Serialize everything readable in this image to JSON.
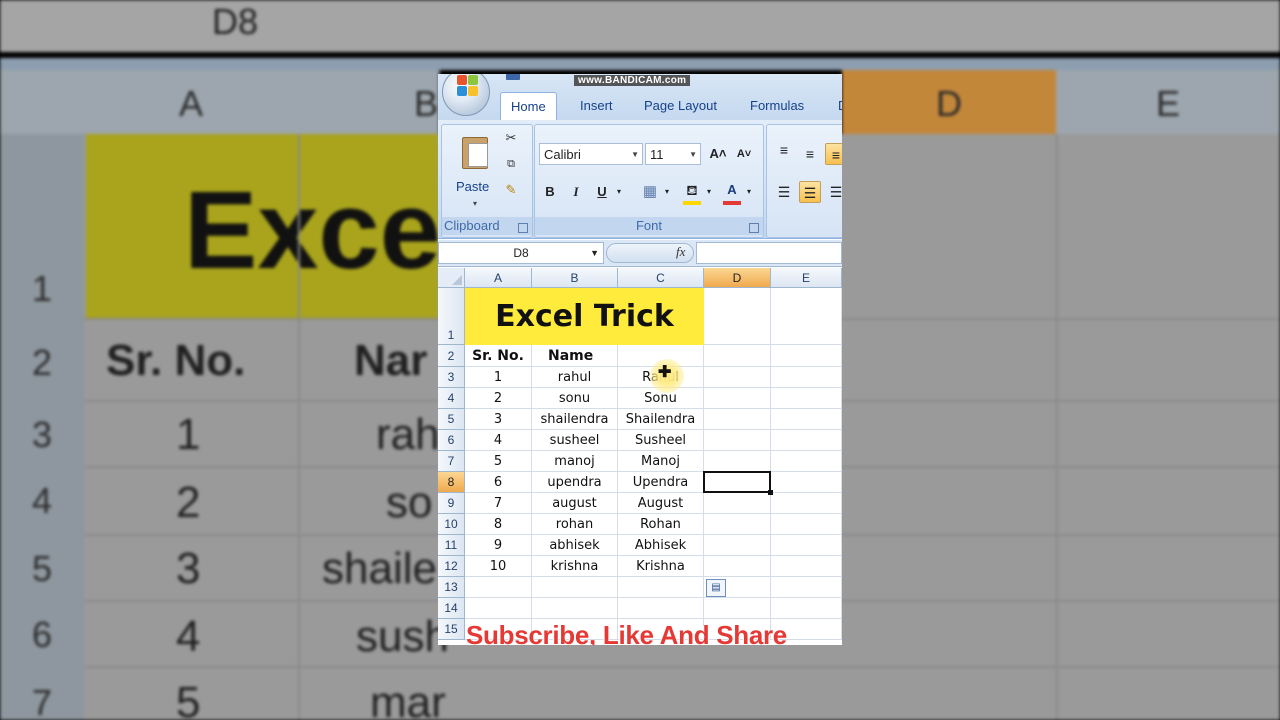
{
  "watermark": "www.BANDICAM.com",
  "ribbon": {
    "tabs": [
      "Home",
      "Insert",
      "Page Layout",
      "Formulas",
      "D"
    ],
    "active_tab": "Home",
    "clipboard": {
      "paste_label": "Paste",
      "group_label": "Clipboard"
    },
    "font": {
      "font_name": "Calibri",
      "font_size": "11",
      "group_label": "Font",
      "bold": "B",
      "italic": "I",
      "underline": "U",
      "grow": "A˄",
      "shrink": "A˅",
      "font_color_letter": "A",
      "fill_color": "#ffd700",
      "font_color": "#e53935"
    },
    "alignment": {
      "note": ""
    }
  },
  "formula_bar": {
    "name_box": "D8",
    "fx": "fx",
    "value": ""
  },
  "sheet": {
    "columns": [
      "A",
      "B",
      "C",
      "D",
      "E"
    ],
    "selected_column": "D",
    "selected_row": "8",
    "rows": [
      "1",
      "2",
      "3",
      "4",
      "5",
      "6",
      "7",
      "8",
      "9",
      "10",
      "11",
      "12",
      "13",
      "14",
      "15"
    ],
    "title": "Excel Trick",
    "headers": {
      "a": "Sr. No.",
      "b": "Name"
    },
    "data": [
      {
        "a": "1",
        "b": "rahul",
        "c": "Rahul"
      },
      {
        "a": "2",
        "b": "sonu",
        "c": "Sonu"
      },
      {
        "a": "3",
        "b": "shailendra",
        "c": "Shailendra"
      },
      {
        "a": "4",
        "b": "susheel",
        "c": "Susheel"
      },
      {
        "a": "5",
        "b": "manoj",
        "c": "Manoj"
      },
      {
        "a": "6",
        "b": "upendra",
        "c": "Upendra"
      },
      {
        "a": "7",
        "b": "august",
        "c": "August"
      },
      {
        "a": "8",
        "b": "rohan",
        "c": "Rohan"
      },
      {
        "a": "9",
        "b": "abhisek",
        "c": "Abhisek"
      },
      {
        "a": "10",
        "b": "krishna",
        "c": "Krishna"
      }
    ],
    "title_fill": "#ffeb3b"
  },
  "overlay": {
    "subscribe_text": "Subscribe, Like And Share",
    "subscribe_color": "#e53935"
  },
  "background": {
    "name_box": "D8",
    "columns": [
      "A",
      "B",
      "D",
      "E"
    ],
    "rows": [
      "1",
      "2",
      "3",
      "4",
      "5",
      "6",
      "7"
    ],
    "big_title": "Excel",
    "col_a": [
      "Sr. No.",
      "1",
      "2",
      "3",
      "4",
      "5"
    ],
    "col_b": [
      "Nar",
      "rah",
      "so",
      "shaile",
      "sush",
      "mar"
    ]
  }
}
